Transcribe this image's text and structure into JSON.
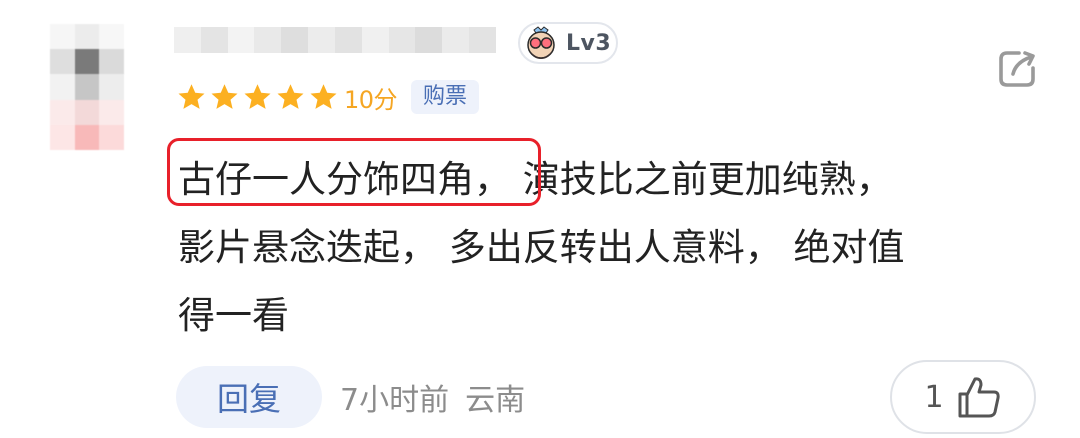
{
  "comment_card": {
    "level_badge": "Lv3",
    "rating": {
      "stars_filled": 5,
      "stars_total": 5,
      "score_text": "10分",
      "tag": "购票"
    },
    "comment": {
      "lines": [
        "古仔一人分饰四角， 演技比之前更加纯熟，",
        "影片悬念迭起， 多出反转出人意料， 绝对值",
        "得一看"
      ],
      "highlighted_text": "古仔一人分饰四角，"
    },
    "footer": {
      "reply_label": "回复",
      "time": "7小时前",
      "location": "云南",
      "like_count": "1"
    }
  },
  "colors": {
    "star": "#fcb021",
    "accent_blue": "#4a6fb5",
    "highlight_red": "#e8202a"
  },
  "icons": {
    "share": "share-arrow-icon",
    "like": "thumbs-up-icon",
    "level": "level-mascot-icon",
    "star": "star-icon"
  }
}
